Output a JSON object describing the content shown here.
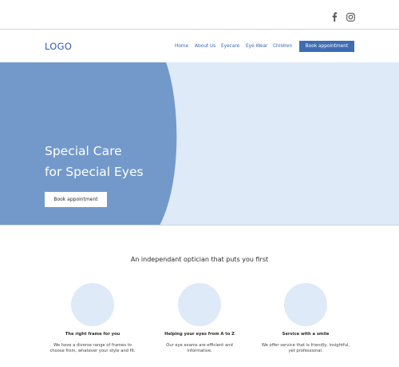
{
  "topbar": {
    "social": [
      {
        "icon": "facebook-icon"
      },
      {
        "icon": "instagram-icon"
      }
    ]
  },
  "header": {
    "logo": "LOGO",
    "nav": [
      {
        "label": "Home"
      },
      {
        "label": "About Us"
      },
      {
        "label": "Eyecare"
      },
      {
        "label": "Eye Wear"
      },
      {
        "label": "Children"
      }
    ],
    "cta_label": "Book appointment"
  },
  "hero": {
    "title_line1": "Special Care",
    "title_line2": "for Special Eyes",
    "button_label": "Book appointment"
  },
  "intro": {
    "title": "An independant optician that puts you first"
  },
  "features": [
    {
      "title": "The right frame for you",
      "description": "We have a diverse range of frames to\nchoose from, whatever your style and fit."
    },
    {
      "title": "Helping your eyes from A to Z",
      "description": "Our eye exams are efficient and\ninformative."
    },
    {
      "title": "Service with a smile",
      "description": "We offer service that is friendly, insightful,\nyet professional."
    }
  ],
  "colors": {
    "accent": "#3e6db4",
    "hero_left": "#7399ca",
    "hero_right": "#dfeaf8",
    "circle": "#dfeaf8"
  }
}
